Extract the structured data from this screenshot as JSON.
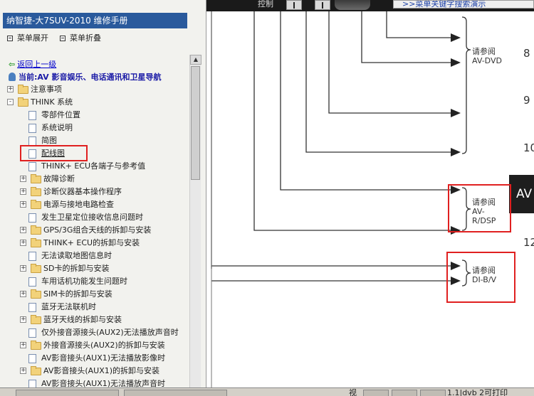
{
  "window": {
    "title": "纳智捷-大7SUV-2010 维修手册"
  },
  "toolbar": {
    "label": "控制",
    "search_demo": ">>菜单关键字搜索演示"
  },
  "menu": {
    "expand_label": "菜单展开",
    "collapse_label": "菜单折叠"
  },
  "nav": {
    "back_label": "返回上一级",
    "current_label": "当前:AV 影音娱乐、电话通讯和卫星导航"
  },
  "tree": {
    "nodes": [
      {
        "label": "注意事项",
        "type": "folder",
        "level": 0,
        "expand": "+"
      },
      {
        "label": "THINK 系统",
        "type": "folder",
        "level": 0,
        "expand": "-"
      },
      {
        "label": "零部件位置",
        "type": "doc",
        "level": 1
      },
      {
        "label": "系统说明",
        "type": "doc",
        "level": 1
      },
      {
        "label": "简图",
        "type": "doc",
        "level": 1
      },
      {
        "label": "配线图",
        "type": "doc",
        "level": 1,
        "selected": true
      },
      {
        "label": "THINK+ ECU各端子与参考值",
        "type": "doc",
        "level": 1
      },
      {
        "label": "故障诊断",
        "type": "folder",
        "level": 1,
        "expand": "+"
      },
      {
        "label": "诊断仪器基本操作程序",
        "type": "folder",
        "level": 1,
        "expand": "+"
      },
      {
        "label": "电源与接地电路检查",
        "type": "folder",
        "level": 1,
        "expand": "+"
      },
      {
        "label": "发生卫星定位接收信息问题时",
        "type": "doc",
        "level": 1
      },
      {
        "label": "GPS/3G组合天线的拆卸与安装",
        "type": "folder",
        "level": 1,
        "expand": "+"
      },
      {
        "label": "THINK+ ECU的拆卸与安装",
        "type": "folder",
        "level": 1,
        "expand": "+"
      },
      {
        "label": "无法读取地图信息时",
        "type": "doc",
        "level": 1
      },
      {
        "label": "SD卡的拆卸与安装",
        "type": "folder",
        "level": 1,
        "expand": "+"
      },
      {
        "label": "车用话机功能发生问题时",
        "type": "doc",
        "level": 1
      },
      {
        "label": "SIM卡的拆卸与安装",
        "type": "folder",
        "level": 1,
        "expand": "+"
      },
      {
        "label": "蓝牙无法联机时",
        "type": "doc",
        "level": 1
      },
      {
        "label": "蓝牙天线的拆卸与安装",
        "type": "folder",
        "level": 1,
        "expand": "+"
      },
      {
        "label": "仅外接音源接头(AUX2)无法播放声音时",
        "type": "doc",
        "level": 1
      },
      {
        "label": "外接音源接头(AUX2)的拆卸与安装",
        "type": "folder",
        "level": 1,
        "expand": "+"
      },
      {
        "label": "AV影音接头(AUX1)无法播放影像时",
        "type": "doc",
        "level": 1
      },
      {
        "label": "AV影音接头(AUX1)的拆卸与安装",
        "type": "folder",
        "level": 1,
        "expand": "+"
      },
      {
        "label": "AV影音接头(AUX1)无法播放声音时",
        "type": "doc",
        "level": 1
      }
    ]
  },
  "diagram": {
    "refs": [
      {
        "line1": "请参阅",
        "line2": "AV-DVD",
        "line3": ""
      },
      {
        "line1": "请参阅",
        "line2": "AV-",
        "line3": "R/DSP"
      },
      {
        "line1": "请参阅",
        "line2": "DI-B/V",
        "line3": ""
      }
    ],
    "numbers": [
      "8",
      "9",
      "10",
      "12"
    ],
    "av_box_label": "AV"
  },
  "statusbar": {
    "text1": "视",
    "text2": "1.1|dvb 2可打印"
  }
}
